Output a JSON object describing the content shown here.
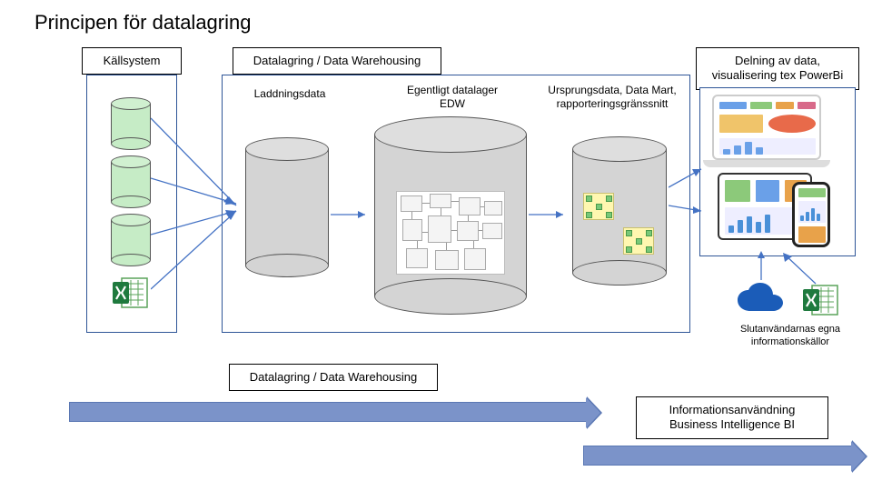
{
  "title": "Principen för datalagring",
  "labels": {
    "source": "Källsystem",
    "warehouse": "Datalagring / Data Warehousing",
    "delivery_line1": "Delning av data,",
    "delivery_line2": "visualisering tex PowerBi",
    "staging": "Laddningsdata",
    "edw_line1": "Egentligt datalager",
    "edw_line2": "EDW",
    "mart_line1": "Ursprungsdata, Data Mart,",
    "mart_line2": "rapporteringsgränssnitt",
    "enduser_line1": "Slutanvändarnas egna",
    "enduser_line2": "informationskällor",
    "bottom_dw": "Datalagring / Data Warehousing",
    "bottom_bi_line1": "Informationsanvändning",
    "bottom_bi_line2": "Business Intelligence BI"
  },
  "icons": {
    "source_db_1": "database-icon",
    "source_db_2": "database-icon",
    "source_db_3": "database-icon",
    "source_excel": "excel-icon",
    "staging_cyl": "database-icon",
    "edw_cyl": "database-icon",
    "mart_cyl": "database-icon",
    "onedrive": "onedrive-cloud-icon",
    "user_excel": "excel-icon",
    "dashboards": "bi-dashboard-icon"
  }
}
